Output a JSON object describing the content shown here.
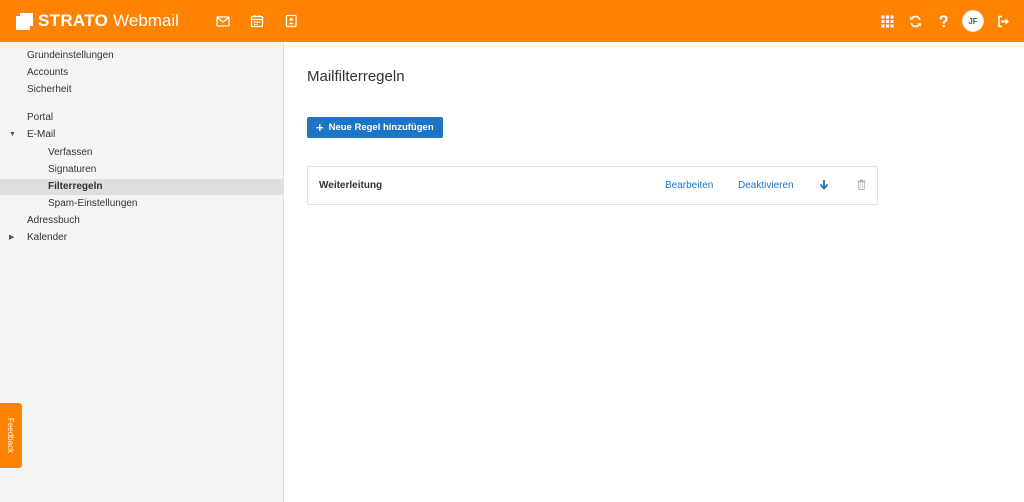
{
  "header": {
    "brand": "STRATO",
    "product": "Webmail",
    "apps": [
      {
        "icon": "mail-icon"
      },
      {
        "icon": "calendar-icon"
      },
      {
        "icon": "address-book-icon"
      }
    ],
    "actions": [
      {
        "icon": "apps-grid-icon"
      },
      {
        "icon": "refresh-icon"
      },
      {
        "icon": "help-icon"
      }
    ],
    "avatar_initials": "JF",
    "logout_icon": "logout-icon"
  },
  "sidebar": {
    "items": [
      {
        "label": "Grundeinstellungen"
      },
      {
        "label": "Accounts"
      },
      {
        "label": "Sicherheit"
      },
      {
        "label": "Portal"
      },
      {
        "label": "E-Mail",
        "caret": "▼"
      },
      {
        "label": "Verfassen"
      },
      {
        "label": "Signaturen"
      },
      {
        "label": "Filterregeln",
        "active": true
      },
      {
        "label": "Spam-Einstellungen"
      },
      {
        "label": "Adressbuch"
      },
      {
        "label": "Kalender",
        "caret": "▶"
      }
    ]
  },
  "feedback_label": "Feedback",
  "main": {
    "title": "Mailfilterregeln",
    "add_button": "Neue Regel hinzufügen",
    "rules": [
      {
        "name": "Weiterleitung",
        "edit": "Bearbeiten",
        "toggle": "Deaktivieren"
      }
    ]
  },
  "colors": {
    "brand_orange": "#ff8200",
    "link_blue": "#1f75c4"
  }
}
